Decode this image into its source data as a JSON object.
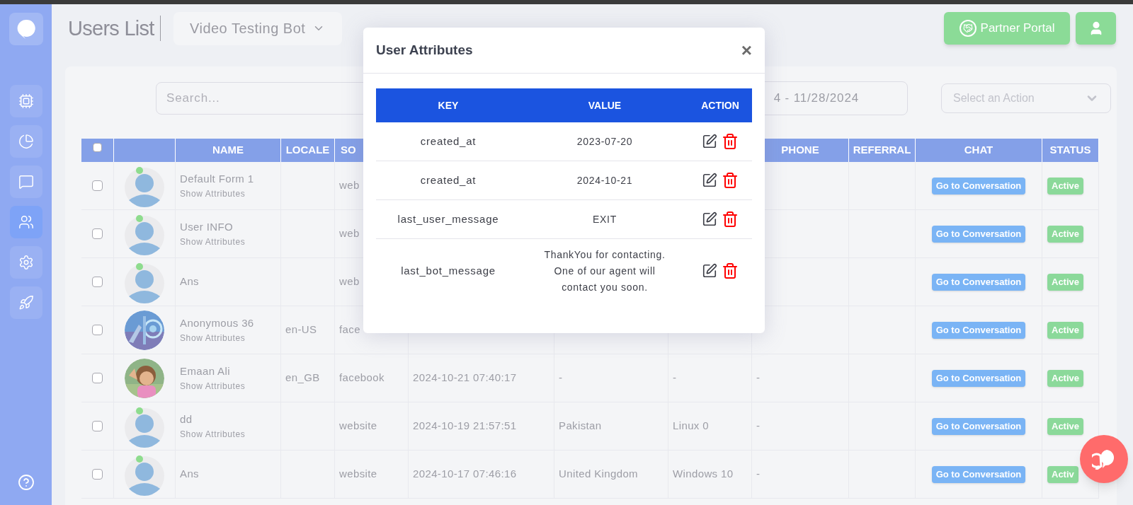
{
  "sidebar": {
    "items": [
      {
        "selected": false
      },
      {
        "selected": false
      },
      {
        "selected": false
      },
      {
        "selected": true
      },
      {
        "selected": false
      },
      {
        "selected": false
      }
    ]
  },
  "header": {
    "title": "Users List",
    "bot_selector": "Video Testing Bot",
    "buttons": [
      {
        "kind": "partner",
        "label": "Partner Portal"
      },
      {
        "kind": "profile"
      }
    ]
  },
  "filters": {
    "search": {
      "placeholder": "Search..."
    },
    "date_range": "4 - 11/28/2024",
    "action_select": {
      "placeholder": "Select an Action"
    }
  },
  "table": {
    "select_all_checked": false,
    "columns": [
      "",
      "",
      "NAME",
      "LOCALE",
      "SO",
      "",
      "",
      "",
      "PHONE",
      "REFERRAL",
      "CHAT",
      "STATUS"
    ],
    "rows": [
      {
        "checked": false,
        "avatar": {
          "kind": "default"
        },
        "name": "Default Form 1",
        "show_attributes": "Show Attributes",
        "locale": "",
        "source": "web",
        "date": "",
        "country": "",
        "os": "",
        "phone": "",
        "referral": "",
        "chat": "Go to Conversation",
        "status": "Active"
      },
      {
        "checked": false,
        "avatar": {
          "kind": "default"
        },
        "name": "User INFO",
        "show_attributes": "Show Attributes",
        "locale": "",
        "source": "web",
        "date": "",
        "country": "",
        "os": "",
        "phone": "",
        "referral": "",
        "chat": "Go to Conversation",
        "status": "Active"
      },
      {
        "checked": false,
        "avatar": {
          "kind": "default"
        },
        "name": "Ans",
        "locale": "",
        "source": "web",
        "date": "",
        "country": "",
        "os": "",
        "phone": "",
        "referral": "",
        "chat": "Go to Conversation",
        "status": "Active"
      },
      {
        "checked": false,
        "name": "Anonymous 36",
        "show_attributes": "Show Attributes",
        "locale": "en-US",
        "source": "face",
        "date": "",
        "country": "",
        "os": "",
        "phone": "",
        "referral": "",
        "chat": "Go to Conversation",
        "status": "Active"
      },
      {
        "checked": false,
        "name": "Emaan Ali",
        "show_attributes": "Show Attributes",
        "locale": "en_GB",
        "source": "facebook",
        "date": "2024-10-21 07:40:17",
        "country": "-",
        "os": "-",
        "phone": "-",
        "referral": "",
        "chat": "Go to Conversation",
        "status": "Active"
      },
      {
        "checked": false,
        "avatar": {
          "kind": "default"
        },
        "name": "dd",
        "show_attributes": "Show Attributes",
        "locale": "",
        "source": "website",
        "date": "2024-10-19 21:57:51",
        "country": "Pakistan",
        "os": "Linux 0",
        "phone": "-",
        "referral": "",
        "chat": "Go to Conversation",
        "status": "Active"
      },
      {
        "checked": false,
        "avatar": {
          "kind": "default"
        },
        "name": "Ans",
        "locale": "",
        "source": "website",
        "date": "2024-10-17 07:46:16",
        "country": "United Kingdom",
        "os": "Windows 10",
        "phone": "-",
        "referral": "",
        "chat": "Go to Conversation",
        "status": "Activ"
      }
    ]
  },
  "modal": {
    "title": "User Attributes",
    "close": "×",
    "columns": [
      "KEY",
      "VALUE",
      "ACTION"
    ],
    "rows": [
      {
        "key": "created_at",
        "value": "2023-07-20"
      },
      {
        "key": "created_at",
        "value": "2024-10-21"
      },
      {
        "key": "last_user_message",
        "value": "EXIT"
      },
      {
        "key": "last_bot_message",
        "value": "ThankYou for contacting. One of our agent will contact you soon."
      }
    ]
  }
}
